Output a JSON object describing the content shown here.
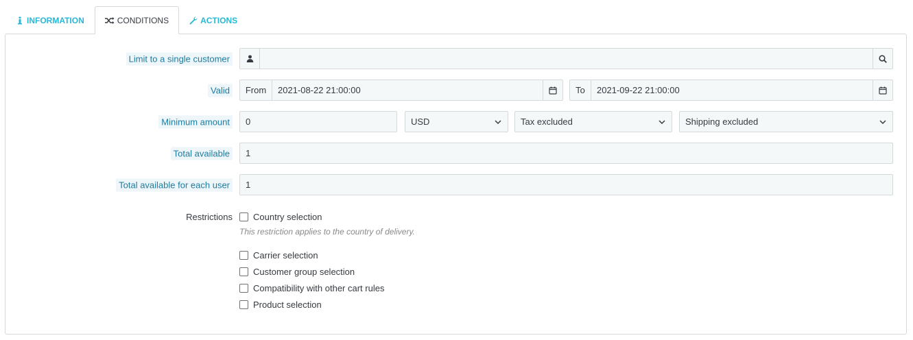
{
  "tabs": [
    {
      "label": "Information",
      "icon": "info-icon",
      "active": false
    },
    {
      "label": "Conditions",
      "icon": "shuffle-icon",
      "active": true
    },
    {
      "label": "Actions",
      "icon": "wrench-icon",
      "active": false
    }
  ],
  "form": {
    "customer": {
      "label": "Limit to a single customer",
      "value": "",
      "icon_left": "user-icon",
      "icon_right": "search-icon"
    },
    "valid": {
      "label": "Valid",
      "from_label": "From",
      "from_value": "2021-08-22 21:00:00",
      "to_label": "To",
      "to_value": "2021-09-22 21:00:00",
      "icon": "calendar-icon"
    },
    "minimum_amount": {
      "label": "Minimum amount",
      "value": "0",
      "currency": "USD",
      "tax": "Tax excluded",
      "shipping": "Shipping excluded"
    },
    "total_available": {
      "label": "Total available",
      "value": "1"
    },
    "total_per_user": {
      "label": "Total available for each user",
      "value": "1"
    },
    "restrictions": {
      "label": "Restrictions",
      "country": "Country selection",
      "country_hint": "This restriction applies to the country of delivery.",
      "carrier": "Carrier selection",
      "customer_group": "Customer group selection",
      "compatibility": "Compatibility with other cart rules",
      "product": "Product selection"
    }
  },
  "colors": {
    "accent": "#25b9d7",
    "label_highlight": "#1d7ca0",
    "field_bg": "#f4f8f9",
    "border": "#d3d8db"
  }
}
